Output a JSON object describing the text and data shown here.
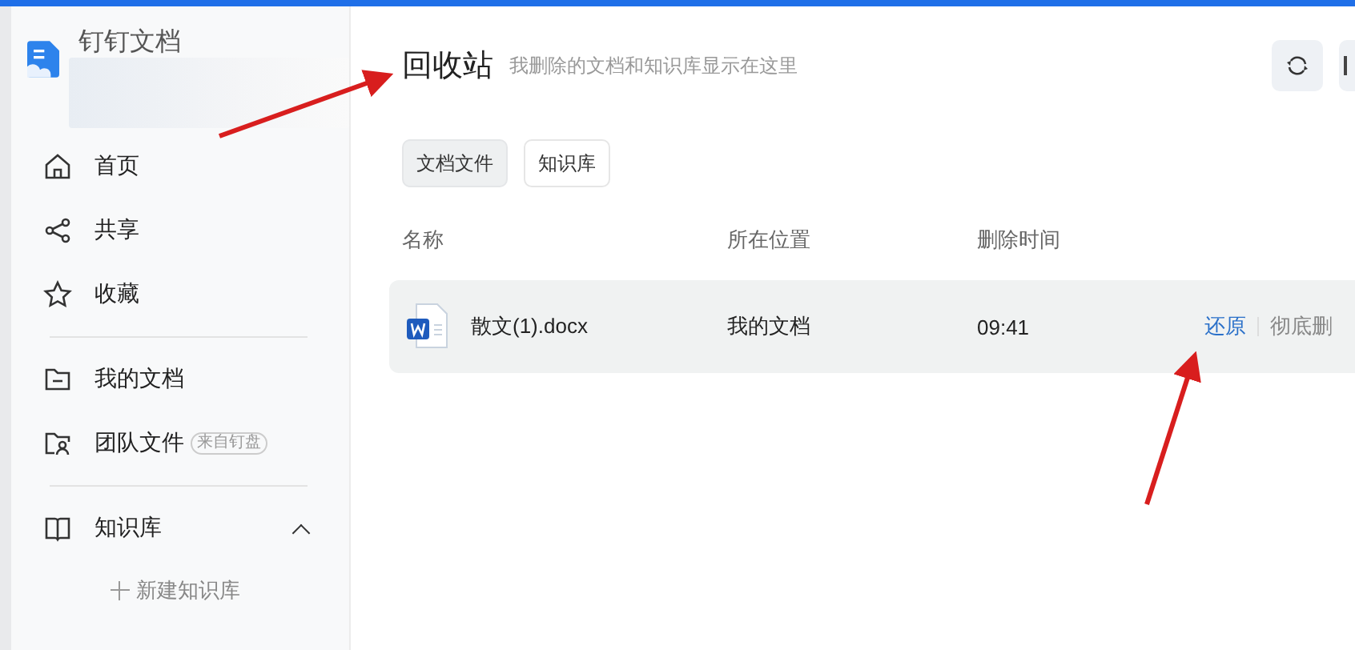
{
  "app": {
    "title": "钉钉文档"
  },
  "sidebar": {
    "sections": [
      {
        "items": [
          {
            "label": "首页"
          },
          {
            "label": "共享"
          },
          {
            "label": "收藏"
          }
        ]
      },
      {
        "items": [
          {
            "label": "我的文档"
          },
          {
            "label": "团队文件",
            "badge": "来自钉盘"
          }
        ]
      },
      {
        "items": [
          {
            "label": "知识库",
            "expanded": true
          }
        ]
      }
    ],
    "new_button": {
      "label": "新建知识库"
    }
  },
  "page": {
    "title": "回收站",
    "subtitle": "我删除的文档和知识库显示在这里"
  },
  "tabs": [
    {
      "label": "文档文件",
      "selected": true
    },
    {
      "label": "知识库",
      "selected": false
    }
  ],
  "table": {
    "columns": [
      "名称",
      "所在位置",
      "删除时间"
    ],
    "rows": [
      {
        "name": "散文(1).docx",
        "location": "我的文档",
        "time": "09:41",
        "actions": [
          "还原",
          "彻底删"
        ]
      }
    ]
  }
}
